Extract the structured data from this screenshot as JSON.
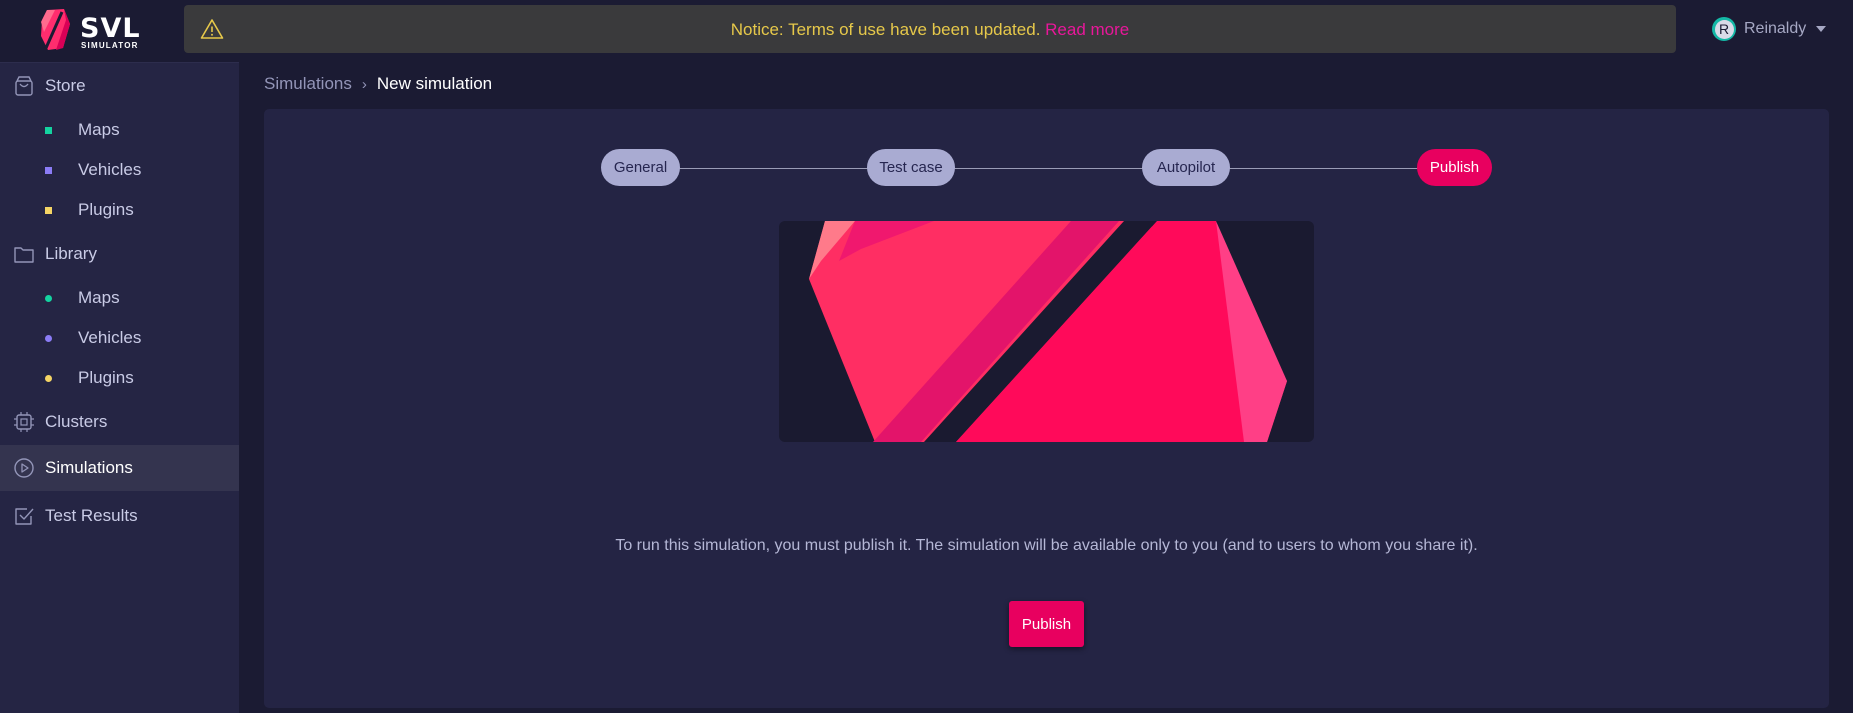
{
  "app": {
    "logo_text": "SVL",
    "logo_sub": "SIMULATOR"
  },
  "notice": {
    "text": "Notice: Terms of use have been updated. ",
    "link": "Read more",
    "icon": "warning-icon",
    "text_color": "#e6c84a",
    "link_color": "#e8179a"
  },
  "user": {
    "initial": "R",
    "name": "Reinaldy"
  },
  "sidebar": {
    "items": [
      {
        "label": "Store",
        "icon": "shopping-bag-icon"
      },
      {
        "label": "Maps",
        "marker": "square",
        "color": "#14d3a0"
      },
      {
        "label": "Vehicles",
        "marker": "square",
        "color": "#8b7cf6"
      },
      {
        "label": "Plugins",
        "marker": "square",
        "color": "#f5d565"
      },
      {
        "label": "Library",
        "icon": "folder-icon"
      },
      {
        "label": "Maps",
        "marker": "circle",
        "color": "#14d3a0"
      },
      {
        "label": "Vehicles",
        "marker": "circle",
        "color": "#8b7cf6"
      },
      {
        "label": "Plugins",
        "marker": "circle",
        "color": "#f5d565"
      },
      {
        "label": "Clusters",
        "icon": "chip-icon"
      },
      {
        "label": "Simulations",
        "icon": "play-circle-icon",
        "active": true
      },
      {
        "label": "Test Results",
        "icon": "check-square-icon"
      }
    ]
  },
  "breadcrumb": {
    "parent": "Simulations",
    "separator": "›",
    "current": "New simulation"
  },
  "steps": [
    {
      "label": "General"
    },
    {
      "label": "Test case"
    },
    {
      "label": "Autopilot"
    },
    {
      "label": "Publish",
      "active": true
    }
  ],
  "publish": {
    "description": "To run this simulation, you must publish it. The simulation will be available only to you (and to users to whom you share it).",
    "button_label": "Publish"
  },
  "colors": {
    "accent": "#e8005f",
    "background": "#1b1b33",
    "sidebar": "#252544",
    "panel": "#242444"
  }
}
